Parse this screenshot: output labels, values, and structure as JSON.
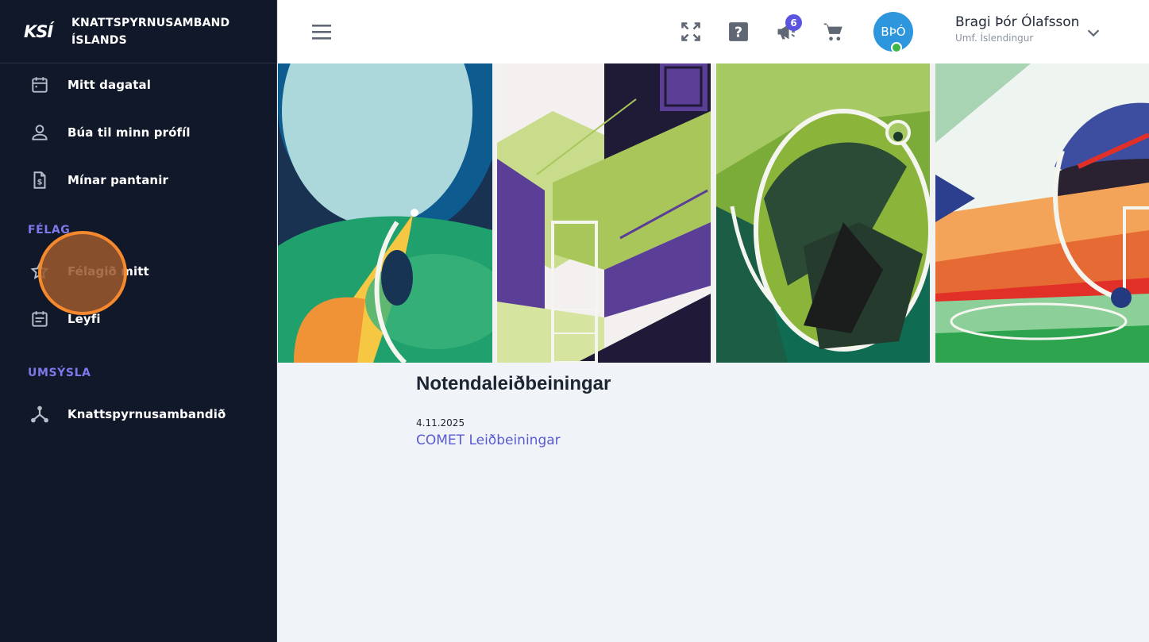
{
  "brand": {
    "logo_text": "KSÍ",
    "name_line1": "KNATTSPYRNUSAMBAND",
    "name_line2": "ÍSLANDS"
  },
  "sidebar": {
    "items": [
      {
        "label": "Mitt dagatal",
        "icon": "calendar-icon"
      },
      {
        "label": "Búa til minn prófíl",
        "icon": "person-icon"
      },
      {
        "label": "Mínar pantanir",
        "icon": "invoice-icon"
      }
    ],
    "sections": [
      {
        "title": "FÉLAG",
        "items": [
          {
            "label": "Félagið mitt",
            "icon": "star-icon"
          },
          {
            "label": "Leyfi",
            "icon": "document-icon"
          }
        ]
      },
      {
        "title": "UMSÝSLA",
        "items": [
          {
            "label": "Knattspyrnusambandið",
            "icon": "hierarchy-icon"
          }
        ]
      }
    ]
  },
  "topbar": {
    "notifications_count": "6",
    "user": {
      "initials": "BÞÓ",
      "name": "Bragi Þór Ólafsson",
      "club": "Umf. Íslendingur"
    }
  },
  "content": {
    "title": "Notendaleiðbeiningar",
    "entries": [
      {
        "date": "4.11.2025",
        "link": "COMET Leiðbeiningar"
      }
    ]
  },
  "colors": {
    "sidebar_bg": "#101829",
    "section_title": "#7d79ea",
    "accent": "#5b5bd1",
    "avatar": "#2e96dc",
    "badge": "#5a54e0",
    "status_online": "#3eb64a"
  }
}
